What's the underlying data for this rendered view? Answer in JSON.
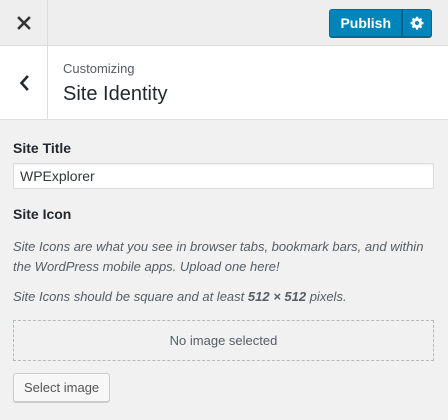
{
  "topbar": {
    "close_icon": "close-icon",
    "publish_label": "Publish",
    "settings_icon": "gear-icon"
  },
  "section_header": {
    "back_icon": "chevron-left-icon",
    "eyebrow": "Customizing",
    "title": "Site Identity"
  },
  "site_title": {
    "label": "Site Title",
    "value": "WPExplorer"
  },
  "site_icon": {
    "label": "Site Icon",
    "description": "Site Icons are what you see in browser tabs, bookmark bars, and within the WordPress mobile apps. Upload one here!",
    "size_note_prefix": "Site Icons should be square and at least ",
    "size_note_size": "512 × 512",
    "size_note_suffix": " pixels.",
    "placeholder": "No image selected",
    "select_button": "Select image"
  },
  "colors": {
    "primary": "#0085ba",
    "background": "#f1f1f1"
  }
}
